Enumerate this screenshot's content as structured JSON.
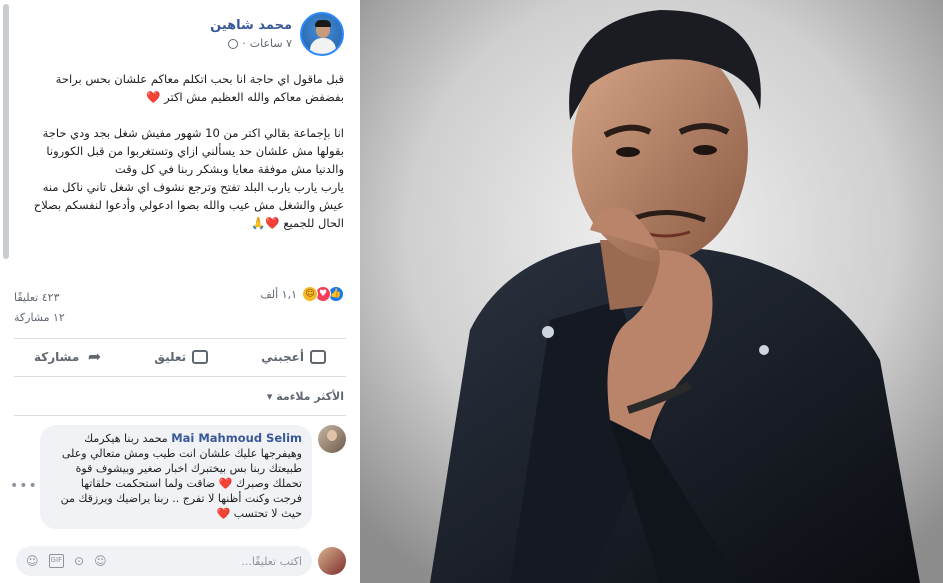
{
  "post": {
    "author": "محمد شاهين",
    "time": "٧ ساعات",
    "paragraphs": [
      "قبل ماقول اي حاجة انا بحب اتكلم معاكم علشان بحس براحة بفضفض معاكم والله العظيم مش اكتر ❤️",
      "انا بإجماعة بقالي اكتر من 10 شهور مفيش شغل بجد ودي حاجة بقولها مش علشان حد يسألني ازاي وتستغربوا من قبل الكورونا والدنيا مش موفقة معايا وبشكر ربنا في كل وقت",
      "يارب يارب يارب البلد تفتح وترجع نشوف اي شغل تاني ناكل منه عيش والشغل مش عيب والله بصوا ادعولي وأدعوا لنفسكم بصلاح الحال للجميع ❤️🙏"
    ],
    "reaction_count": "١,١ ألف",
    "comments_count": "٤٢٣ تعليقًا",
    "shares_count": "١٢ مشاركة"
  },
  "actions": {
    "like": "أعجبني",
    "comment": "تعليق",
    "share": "مشاركة"
  },
  "sort_label": "الأكثر ملاءمة ▾",
  "comment": {
    "author": "Mai Mahmoud Selim",
    "text": "محمد ربنا هيكرمك وهيفرجها عليك علشان انت طيب ومش متعالي وعلى طبيعتك ربنا بس بيختبرك اخبار صغير وبيشوف قوة تحملك وصبرك ❤️ ضاقت ولما استحكمت حلقاتها فرجت وكنت أظنها لا تفرج .. ربنا يراضيك ويرزقك من حيث لا تحتسب ❤️"
  },
  "composer": {
    "placeholder": "اكتب تعليقًا..."
  }
}
